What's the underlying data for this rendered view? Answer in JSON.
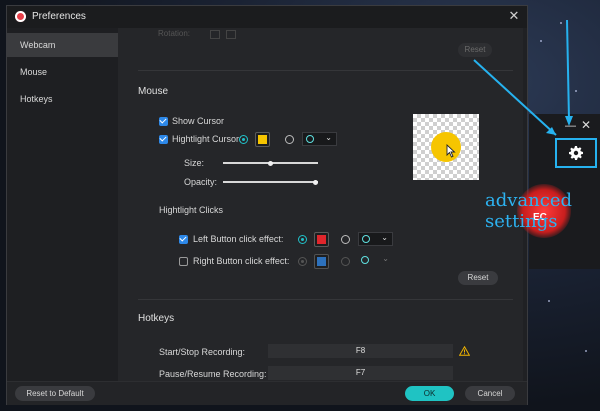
{
  "window": {
    "title": "Preferences",
    "close_symbol": "✕"
  },
  "sidebar": {
    "items": [
      {
        "label": "Webcam"
      },
      {
        "label": "Mouse"
      },
      {
        "label": "Hotkeys"
      }
    ]
  },
  "webcam": {
    "rotation_label": "Rotation:",
    "reset_label": "Reset"
  },
  "mouse": {
    "section_title": "Mouse",
    "show_cursor_label": "Show Cursor",
    "show_cursor_checked": true,
    "highlight_cursor_label": "Hightlight Cursor:",
    "highlight_cursor_checked": true,
    "highlight_color": "#f6c500",
    "size_label": "Size:",
    "size_value": 0.5,
    "opacity_label": "Opacity:",
    "opacity_value": 1.0,
    "highlight_clicks_label": "Hightlight Clicks",
    "left_click_label": "Left Button click effect:",
    "left_click_checked": true,
    "left_click_color": "#e0262c",
    "right_click_label": "Right Button click effect:",
    "right_click_checked": false,
    "right_click_color": "#2f7fd6",
    "reset_label": "Reset"
  },
  "hotkeys": {
    "section_title": "Hotkeys",
    "rows": [
      {
        "label": "Start/Stop Recording:",
        "key": "F8",
        "warning": true
      },
      {
        "label": "Pause/Resume Recording:",
        "key": "F7",
        "warning": false
      }
    ]
  },
  "footer": {
    "reset_default_label": "Reset to Default",
    "ok_label": "OK",
    "cancel_label": "Cancel"
  },
  "widget": {
    "minimize_symbol": "—",
    "close_symbol": "✕",
    "rec_text": "EC"
  },
  "annotation": {
    "line1": "advanced",
    "line2": "settings"
  },
  "colors": {
    "accent": "#1fc3c3",
    "annotation": "#26b2ef",
    "checkbox": "#2d88e8"
  }
}
